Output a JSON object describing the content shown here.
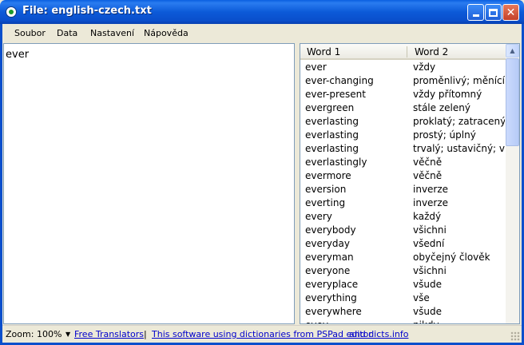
{
  "window": {
    "title": "File: english-czech.txt"
  },
  "menu": {
    "items": [
      "Soubor",
      "Data",
      "Nastavení",
      "Nápověda"
    ]
  },
  "search": {
    "value": "ever"
  },
  "list": {
    "headers": [
      "Word 1",
      "Word 2"
    ],
    "rows": [
      [
        "ever",
        "vždy"
      ],
      [
        "ever-changing",
        "proměnlivý; měnící ..."
      ],
      [
        "ever-present",
        "vždy přítomný"
      ],
      [
        "evergreen",
        "stále zelený"
      ],
      [
        "everlasting",
        "proklatý; zatracený"
      ],
      [
        "everlasting",
        "prostý; úplný"
      ],
      [
        "everlasting",
        "trvalý; ustavičný; vě"
      ],
      [
        "everlastingly",
        "věčně"
      ],
      [
        "evermore",
        "věčně"
      ],
      [
        "eversion",
        "inverze"
      ],
      [
        "everting",
        "inverze"
      ],
      [
        "every",
        "každý"
      ],
      [
        "everybody",
        "všichni"
      ],
      [
        "everyday",
        "všední"
      ],
      [
        "everyman",
        "obyčejný člověk"
      ],
      [
        "everyone",
        "všichni"
      ],
      [
        "everyplace",
        "všude"
      ],
      [
        "everything",
        "vše"
      ],
      [
        "everywhere",
        "všude"
      ],
      [
        "evey",
        "nikdy"
      ]
    ]
  },
  "status": {
    "zoom_label": "Zoom:",
    "zoom_value": "100%",
    "link_translators": "Free Translators",
    "separator": "|",
    "link_software": "This software using dictionaries from PSPad editor",
    "link_dicts": "and dicts.info"
  },
  "colors": {
    "titlebar": "#0a5fe0",
    "link": "#0000cc",
    "close_button": "#c4412a"
  }
}
